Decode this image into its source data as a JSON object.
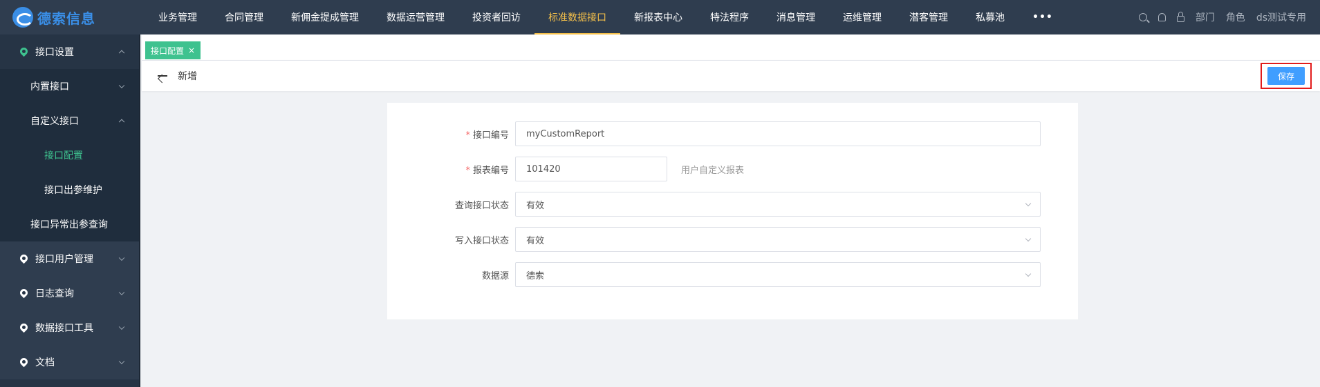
{
  "brand": {
    "name": "德索信息"
  },
  "nav": {
    "items": [
      "业务管理",
      "合同管理",
      "新佣金提成管理",
      "数据运营管理",
      "投资者回访",
      "标准数据接口",
      "新报表中心",
      "特法程序",
      "消息管理",
      "运维管理",
      "潜客管理",
      "私募池"
    ],
    "active_index": 5,
    "more": "•••"
  },
  "topright": {
    "dept": "部门",
    "role": "角色",
    "user": "ds测试专用"
  },
  "sidebar": {
    "items": [
      {
        "label": "接口设置",
        "level": 1,
        "open": true
      },
      {
        "label": "内置接口",
        "level": 2
      },
      {
        "label": "自定义接口",
        "level": 2,
        "open": true
      },
      {
        "label": "接口配置",
        "level": 3,
        "active": true
      },
      {
        "label": "接口出参维护",
        "level": 3
      },
      {
        "label": "接口异常出参查询",
        "level": 2
      },
      {
        "label": "接口用户管理",
        "level": 1
      },
      {
        "label": "日志查询",
        "level": 1
      },
      {
        "label": "数据接口工具",
        "level": 1
      },
      {
        "label": "文档",
        "level": 1
      }
    ]
  },
  "tabs": {
    "active_label": "接口配置",
    "close": "×"
  },
  "header": {
    "title": "新增",
    "save_label": "保存"
  },
  "form": {
    "interface_code": {
      "label": "接口编号",
      "required": true,
      "value": "myCustomReport"
    },
    "report_code": {
      "label": "报表编号",
      "required": true,
      "value": "101420",
      "hint": "用户自定义报表"
    },
    "query_status": {
      "label": "查询接口状态",
      "value": "有效"
    },
    "write_status": {
      "label": "写入接口状态",
      "value": "有效"
    },
    "datasource": {
      "label": "数据源",
      "value": "德索"
    }
  },
  "colors": {
    "topbar": "#2f3d4f",
    "sidebar": "#263445",
    "accent_green": "#3ec28f",
    "nav_active": "#f5c04a",
    "primary": "#409eff",
    "highlight": "#e21b1b"
  }
}
